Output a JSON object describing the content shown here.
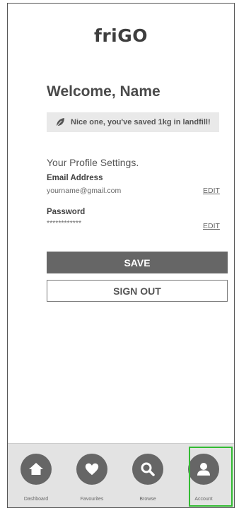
{
  "app": {
    "logo_text": "friGO"
  },
  "header": {
    "welcome_text": "Welcome, Name"
  },
  "banner": {
    "icon": "leaf-icon",
    "text": "Nice one, you've saved 1kg in landfill!"
  },
  "profile": {
    "heading": "Your Profile Settings.",
    "email": {
      "label": "Email Address",
      "value": "yourname@gmail.com",
      "edit_label": "EDIT"
    },
    "password": {
      "label": "Password",
      "value": "************",
      "edit_label": "EDIT"
    }
  },
  "actions": {
    "save_label": "SAVE",
    "signout_label": "SIGN OUT"
  },
  "tabs": [
    {
      "label": "Dashboard",
      "icon": "home-icon",
      "active": false
    },
    {
      "label": "Favourites",
      "icon": "heart-icon",
      "active": false
    },
    {
      "label": "Browse",
      "icon": "search-icon",
      "active": false
    },
    {
      "label": "Account",
      "icon": "user-icon",
      "active": true
    }
  ],
  "colors": {
    "accent_active_outline": "#33bb33",
    "button_dark": "#666666",
    "banner_bg": "#e9e9e9",
    "tab_bar_bg": "#e3e3e3"
  }
}
